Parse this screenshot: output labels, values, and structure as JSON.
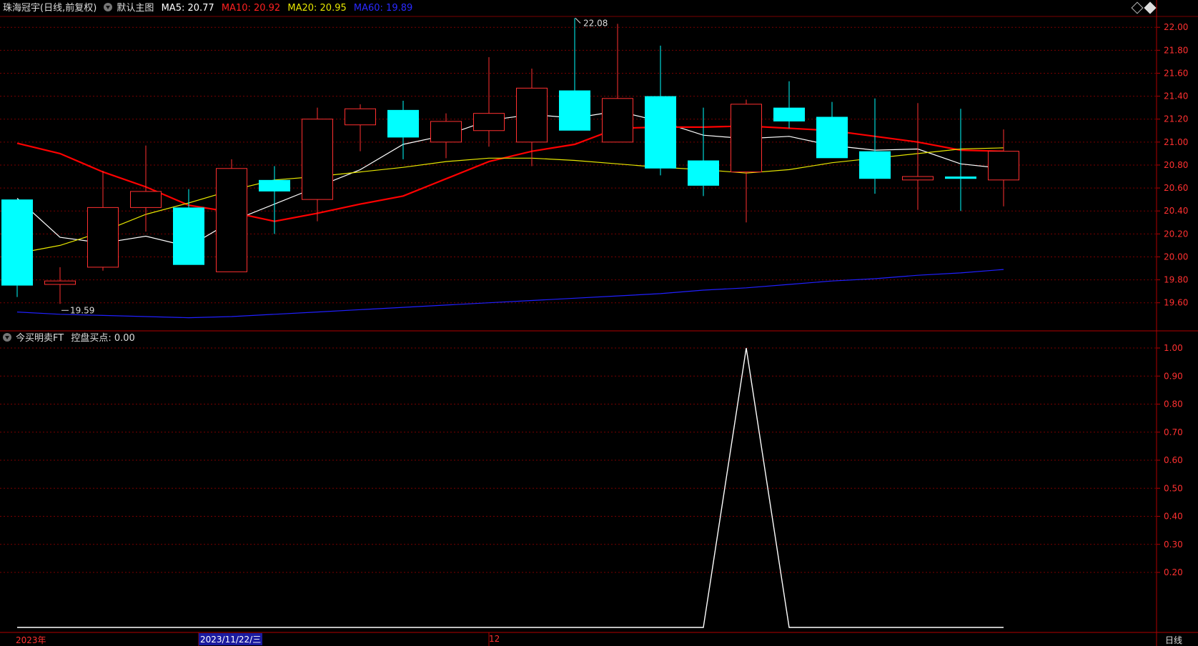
{
  "header": {
    "stock_label": "珠海冠宇(日线,前复权)",
    "view_label": "默认主图",
    "ma5": "MA5: 20.77",
    "ma10": "MA10: 20.92",
    "ma20": "MA20: 20.95",
    "ma60": "MA60: 19.89"
  },
  "indicator": {
    "name_label": "今买明卖FT",
    "value_label": "控盘买点: 0.00"
  },
  "timeline": {
    "year_label": "2023年",
    "cursor_date": "2023/11/22/三",
    "month_label": "12",
    "period_button": "日线"
  },
  "colors": {
    "up": "#ff3030",
    "down": "#00ffff",
    "ma5": "#ffffff",
    "ma10": "#ff0000",
    "ma20": "#e6e600",
    "ma60": "#2020ff",
    "grid": "#7a0000",
    "axis_text": "#ff3030",
    "accent_date_bg": "#1a1aa0"
  },
  "chart_data": [
    {
      "type": "candlestick",
      "ylim": [
        19.5,
        22.1
      ],
      "yticks": [
        "22.00",
        "21.80",
        "21.60",
        "21.40",
        "21.20",
        "21.00",
        "20.80",
        "20.60",
        "20.40",
        "20.20",
        "20.00",
        "19.80",
        "19.60"
      ],
      "annotations": {
        "high_label": "22.08",
        "low_label": "19.59"
      },
      "candles": [
        {
          "o": 20.5,
          "h": 20.5,
          "l": 19.65,
          "c": 19.75
        },
        {
          "o": 19.76,
          "h": 19.91,
          "l": 19.59,
          "c": 19.79
        },
        {
          "o": 19.91,
          "h": 20.75,
          "l": 19.88,
          "c": 20.43
        },
        {
          "o": 20.43,
          "h": 20.97,
          "l": 20.22,
          "c": 20.57
        },
        {
          "o": 20.43,
          "h": 20.59,
          "l": 19.93,
          "c": 19.93
        },
        {
          "o": 19.87,
          "h": 20.85,
          "l": 19.87,
          "c": 20.77
        },
        {
          "o": 20.67,
          "h": 20.79,
          "l": 20.2,
          "c": 20.57
        },
        {
          "o": 20.5,
          "h": 21.3,
          "l": 20.31,
          "c": 21.2
        },
        {
          "o": 21.15,
          "h": 21.33,
          "l": 20.92,
          "c": 21.29
        },
        {
          "o": 21.28,
          "h": 21.36,
          "l": 20.85,
          "c": 21.04
        },
        {
          "o": 21.0,
          "h": 21.25,
          "l": 20.86,
          "c": 21.18
        },
        {
          "o": 21.1,
          "h": 21.74,
          "l": 20.96,
          "c": 21.25
        },
        {
          "o": 21.0,
          "h": 21.64,
          "l": 20.79,
          "c": 21.47
        },
        {
          "o": 21.45,
          "h": 22.08,
          "l": 21.1,
          "c": 21.1
        },
        {
          "o": 21.0,
          "h": 22.03,
          "l": 21.0,
          "c": 21.38
        },
        {
          "o": 21.4,
          "h": 21.84,
          "l": 20.71,
          "c": 20.77
        },
        {
          "o": 20.84,
          "h": 21.3,
          "l": 20.53,
          "c": 20.62
        },
        {
          "o": 20.74,
          "h": 21.37,
          "l": 20.3,
          "c": 21.33
        },
        {
          "o": 21.3,
          "h": 21.53,
          "l": 21.12,
          "c": 21.18
        },
        {
          "o": 21.22,
          "h": 21.35,
          "l": 20.86,
          "c": 20.86
        },
        {
          "o": 20.92,
          "h": 21.38,
          "l": 20.55,
          "c": 20.68
        },
        {
          "o": 20.67,
          "h": 21.34,
          "l": 20.41,
          "c": 20.7
        },
        {
          "o": 20.7,
          "h": 21.29,
          "l": 20.4,
          "c": 20.68
        },
        {
          "o": 20.67,
          "h": 21.11,
          "l": 20.44,
          "c": 20.92
        }
      ],
      "series": [
        {
          "name": "MA5",
          "values": [
            20.51,
            20.17,
            20.12,
            20.18,
            20.09,
            20.31,
            20.46,
            20.61,
            20.76,
            20.98,
            21.06,
            21.19,
            21.24,
            21.21,
            21.27,
            21.18,
            21.06,
            21.03,
            21.05,
            20.97,
            20.93,
            20.94,
            20.81,
            20.77
          ]
        },
        {
          "name": "MA10",
          "values": [
            20.99,
            20.9,
            20.74,
            20.61,
            20.45,
            20.39,
            20.31,
            20.38,
            20.46,
            20.53,
            20.68,
            20.83,
            20.92,
            20.98,
            21.12,
            21.13,
            21.13,
            21.14,
            21.12,
            21.1,
            21.05,
            21.0,
            20.93,
            20.92
          ]
        },
        {
          "name": "MA20",
          "values": [
            20.03,
            20.1,
            20.22,
            20.37,
            20.47,
            20.58,
            20.67,
            20.7,
            20.74,
            20.78,
            20.83,
            20.86,
            20.86,
            20.84,
            20.81,
            20.78,
            20.76,
            20.73,
            20.76,
            20.82,
            20.86,
            20.9,
            20.94,
            20.95
          ]
        },
        {
          "name": "MA60",
          "values": [
            19.52,
            19.5,
            19.49,
            19.48,
            19.47,
            19.48,
            19.5,
            19.52,
            19.54,
            19.56,
            19.58,
            19.6,
            19.62,
            19.64,
            19.66,
            19.68,
            19.71,
            19.73,
            19.76,
            19.79,
            19.81,
            19.84,
            19.86,
            19.89
          ]
        }
      ]
    },
    {
      "type": "line",
      "ylim": [
        0,
        1.0
      ],
      "yticks": [
        "1.00",
        "0.90",
        "0.80",
        "0.70",
        "0.60",
        "0.50",
        "0.40",
        "0.30",
        "0.20"
      ],
      "series": [
        {
          "name": "控盘买点",
          "values": [
            0,
            0,
            0,
            0,
            0,
            0,
            0,
            0,
            0,
            0,
            0,
            0,
            0,
            0,
            0,
            0,
            0,
            1,
            0,
            0,
            0,
            0,
            0,
            0
          ]
        }
      ]
    }
  ]
}
